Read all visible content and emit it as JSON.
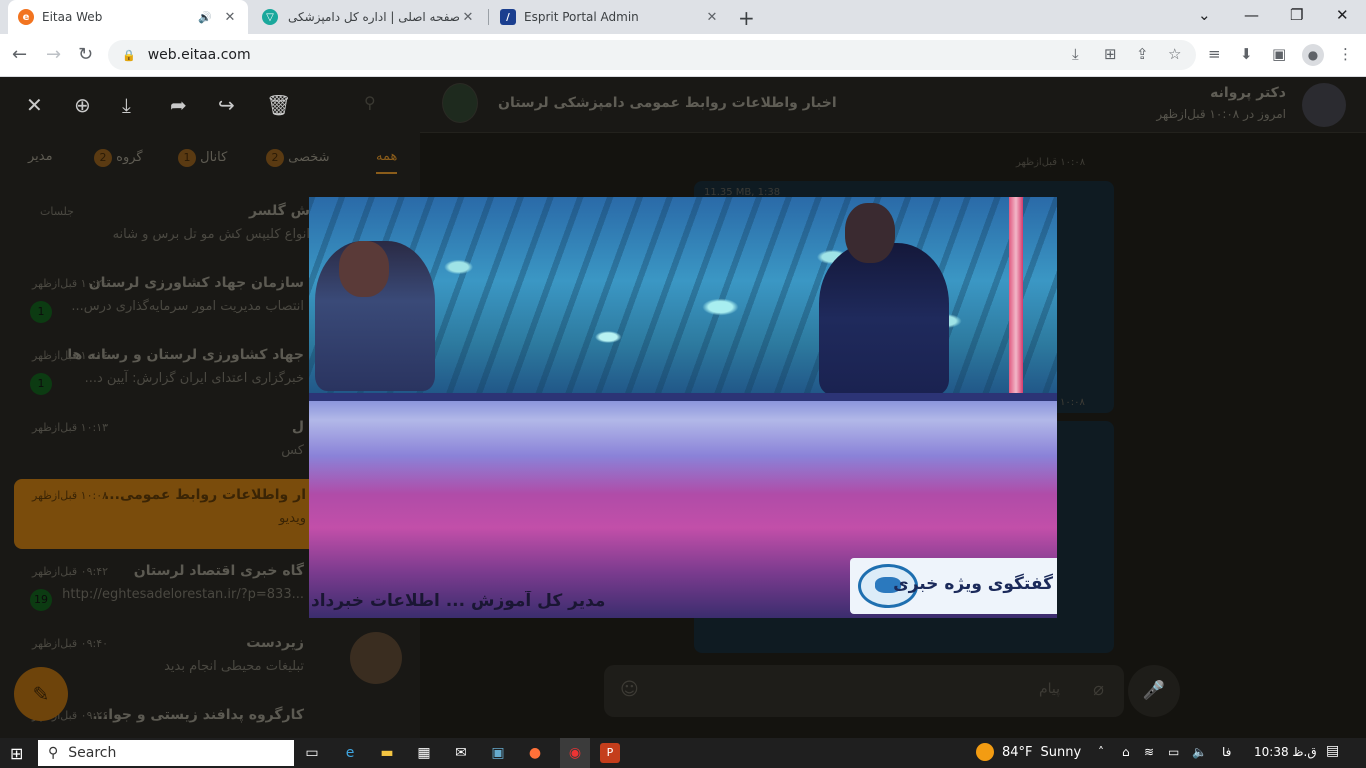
{
  "browser": {
    "tabs": [
      {
        "title": "Eitaa Web",
        "active": true,
        "audio": true
      },
      {
        "title": "صفحه اصلی | اداره کل دامپزشکی",
        "active": false,
        "audio": false
      },
      {
        "title": "Esprit Portal Admin",
        "active": false,
        "audio": false
      }
    ],
    "url": "web.eitaa.com"
  },
  "viewer": {
    "tools": [
      "close-icon",
      "zoom-in-icon",
      "download-icon",
      "forward-icon",
      "share-icon",
      "delete-icon"
    ]
  },
  "filters": [
    {
      "label": "همه",
      "count": ""
    },
    {
      "label": "شخصی",
      "count": "2"
    },
    {
      "label": "کانال",
      "count": "1"
    },
    {
      "label": "گروه",
      "count": "2"
    },
    {
      "label": "مدیر",
      "count": ""
    }
  ],
  "chats": [
    {
      "name": "ش گلسر",
      "preview": "انواع کلیپس کش مو تل برس و شانه",
      "time": "جلسات",
      "badge": ""
    },
    {
      "name": "سازمان جهاد کشاورزی لرستان",
      "preview": "انتصاب مدیریت امور سرمایه‌گذاری درس...",
      "time": "۱۰:۲۰ قبل‌ازظهر",
      "badge": "1"
    },
    {
      "name": "جهاد کشاورزی لرستان و رسانه ها",
      "preview": "خبرگزاری اعتدای ایران گزارش: آیین د...",
      "time": "۱۰:۱۶ قبل‌ازظهر",
      "badge": "1"
    },
    {
      "name": "ل",
      "preview": "کس",
      "time": "۱۰:۱۳ قبل‌ازظهر",
      "badge": ""
    },
    {
      "name": "ار واطلاعات روابط عمومی...",
      "preview": "ویدیو",
      "time": "۱۰:۰۸ قبل‌ازظهر",
      "badge": ""
    },
    {
      "name": "گاه خبری اقتصاد لرستان",
      "preview": "http://eghtesadelorestan.ir/?p=833...",
      "time": "۰۹:۴۲ قبل‌ازظهر",
      "badge": "19"
    },
    {
      "name": "زیردست",
      "preview": "تبلیغات محیطی انجام بدید",
      "time": "۰۹:۴۰ قبل‌ازظهر",
      "badge": ""
    },
    {
      "name": "کارگروه پدافند زیستی و جوا...",
      "preview": "",
      "time": "۰۹:۲۶ قبل‌ازظهر",
      "badge": ""
    }
  ],
  "chat_header": {
    "channel": "اخبار واطلاعات روابط عمومی دامپزشکی لرستان",
    "user": "دکتر پروانه",
    "status": "امروز در ۱۰:۰۸ قبل‌ازظهر"
  },
  "messages": {
    "stamp1": "۱۰:۰۸ قبل‌ازظهر",
    "video_meta": "11.35 MB, 1:38",
    "stamp2": "۱۰:۰۸"
  },
  "composer": {
    "placeholder": "پیام"
  },
  "video": {
    "logo_text": "گفتگوی ویژه خبری",
    "ticker": "مدیر کل آموزش ... اطلاعات خبرداد"
  },
  "taskbar": {
    "search": "Search",
    "weather_temp": "84°F",
    "weather_text": "Sunny",
    "lang": "فا",
    "time": "10:38 ق.ظ"
  }
}
